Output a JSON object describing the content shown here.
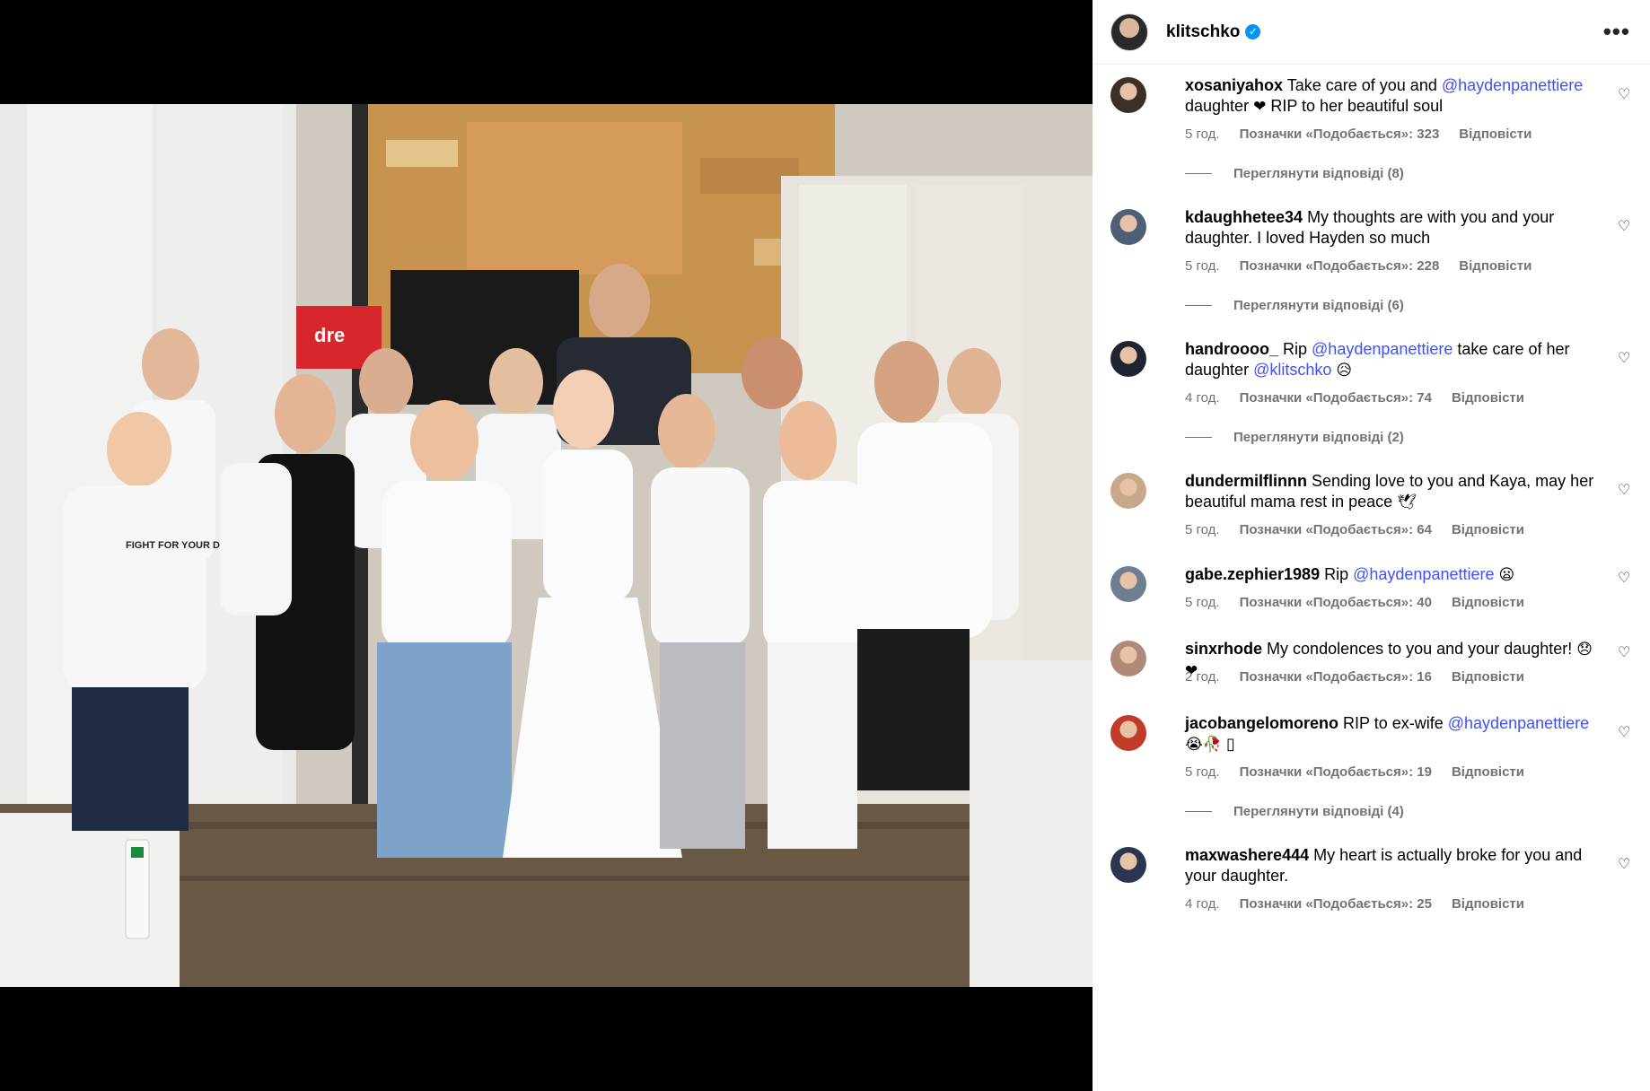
{
  "header": {
    "username": "klitschko",
    "verified_icon": "verified-badge-icon",
    "more_icon": "more-options-icon",
    "more_label": "•••"
  },
  "photo": {
    "shirt_text": "FIGHT FOR YOUR DRE",
    "box_text": "dre"
  },
  "colors": {
    "mention": "#4150f7",
    "meta": "#737373",
    "verified": "#0095f6"
  },
  "comments": [
    {
      "username": "xosaniyahox",
      "parts": [
        "Take care of you and ",
        "@haydenpanettiere",
        " daughter ",
        "❤",
        " RIP to her beautiful soul"
      ],
      "time": "5 год.",
      "likes": "Позначки «Подобається»: 323",
      "reply": "Відповісти",
      "view_replies": "Переглянути відповіді (8)"
    },
    {
      "username": "kdaughhetee34",
      "parts": [
        "My thoughts are with you and your daughter. I loved Hayden so much"
      ],
      "time": "5 год.",
      "likes": "Позначки «Подобається»: 228",
      "reply": "Відповісти",
      "view_replies": "Переглянути відповіді (6)"
    },
    {
      "username": "handroooo_",
      "parts": [
        "Rip ",
        "@haydenpanettiere",
        " take care of her daughter ",
        "@klitschko",
        " ",
        "😥"
      ],
      "time": "4 год.",
      "likes": "Позначки «Подобається»: 74",
      "reply": "Відповісти",
      "view_replies": "Переглянути відповіді (2)"
    },
    {
      "username": "dundermilflinnn",
      "parts": [
        "Sending love to you and Kaya, may her beautiful mama rest in peace ",
        "🕊"
      ],
      "time": "5 год.",
      "likes": "Позначки «Подобається»: 64",
      "reply": "Відповісти"
    },
    {
      "username": "gabe.zephier1989",
      "parts": [
        "Rip ",
        "@haydenpanettiere",
        " ",
        "😦"
      ],
      "time": "5 год.",
      "likes": "Позначки «Подобається»: 40",
      "reply": "Відповісти"
    },
    {
      "username": "sinxrhode",
      "parts": [
        "My condolences to you and your daughter! ",
        "😞❤"
      ],
      "time": "2 год.",
      "likes": "Позначки «Подобається»: 16",
      "reply": "Відповісти"
    },
    {
      "username": "jacobangelomoreno",
      "parts": [
        "RIP to ex-wife ",
        "@haydenpanettiere",
        " ",
        "😭🥀",
        " ▯"
      ],
      "time": "5 год.",
      "likes": "Позначки «Подобається»: 19",
      "reply": "Відповісти",
      "view_replies": "Переглянути відповіді (4)"
    },
    {
      "username": "maxwashere444",
      "parts": [
        "My heart is actually broke for you and your daughter."
      ],
      "time": "4 год.",
      "likes": "Позначки «Подобається»: 25",
      "reply": "Відповісти"
    }
  ]
}
